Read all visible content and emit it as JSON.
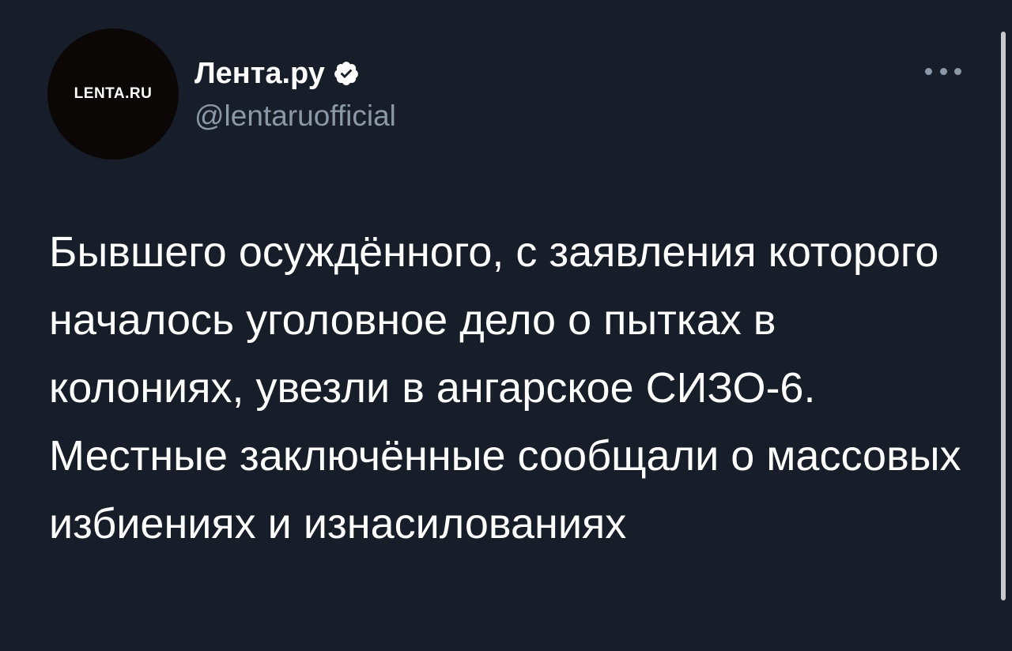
{
  "author": {
    "avatar_text": "LENTA.RU",
    "display_name": "Лента.ру",
    "handle": "@lentaruofficial",
    "verified": true
  },
  "menu": {
    "icon": "more-horizontal-icon"
  },
  "tweet": {
    "text": "Бывшего осуждённого, с заявления которого началось уголовное дело о пытках в колониях, увезли в ангарское СИЗО-6. Местные заключённые сообщали о массовых избиениях и изнасилованиях"
  },
  "colors": {
    "background": "#171d29",
    "text": "#ffffff",
    "secondary_text": "#8b98a5",
    "verified": "#ffffff"
  }
}
